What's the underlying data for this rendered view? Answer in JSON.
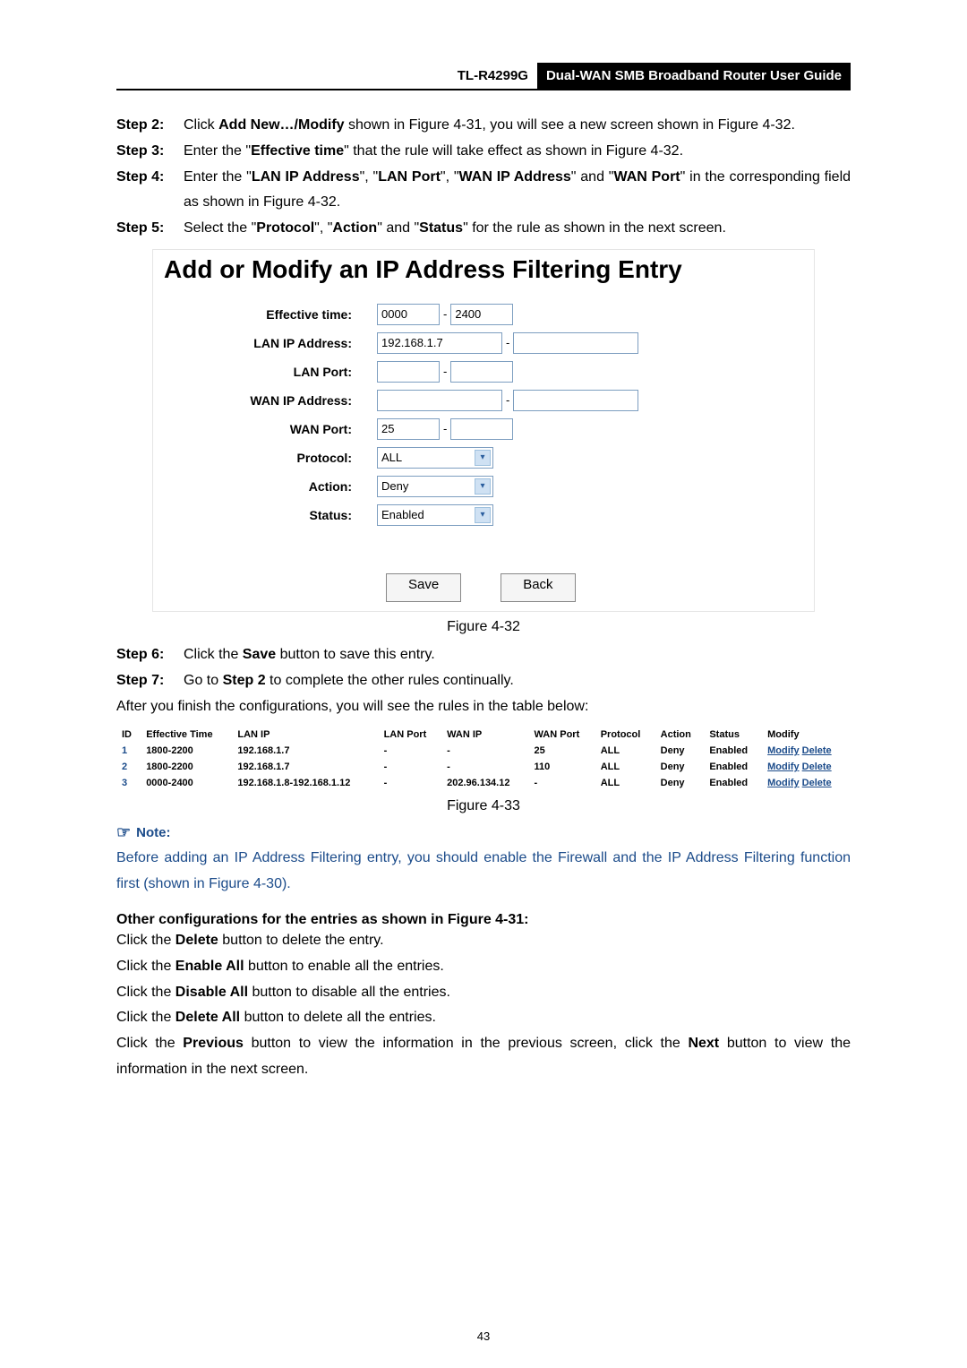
{
  "header": {
    "model": "TL-R4299G",
    "title": "Dual-WAN SMB Broadband Router User Guide"
  },
  "steps_top": {
    "s2_label": "Step 2:",
    "s2_text_1": "Click ",
    "s2_b1": "Add New…/Modify",
    "s2_text_2": " shown in Figure 4-31, you will see a new screen shown in Figure 4-32.",
    "s3_label": "Step 3:",
    "s3_text_1": "Enter the \"",
    "s3_b1": "Effective time",
    "s3_text_2": "\" that the rule will take effect as shown in Figure 4-32.",
    "s4_label": "Step 4:",
    "s4_text_1": "Enter the \"",
    "s4_b1": "LAN IP Address",
    "s4_text_2": "\", \"",
    "s4_b2": "LAN Port",
    "s4_text_3": "\", \"",
    "s4_b3": "WAN IP Address",
    "s4_text_4": "\" and \"",
    "s4_b4": "WAN Port",
    "s4_text_5": "\" in the corresponding field as shown in Figure 4-32.",
    "s5_label": "Step 5:",
    "s5_text_1": "Select the \"",
    "s5_b1": "Protocol",
    "s5_text_2": "\", \"",
    "s5_b2": "Action",
    "s5_text_3": "\" and \"",
    "s5_b3": "Status",
    "s5_text_4": "\" for the rule as shown in the next screen."
  },
  "form": {
    "title": "Add or Modify an IP Address Filtering Entry",
    "labels": {
      "effective_time": "Effective time:",
      "lan_ip": "LAN IP Address:",
      "lan_port": "LAN Port:",
      "wan_ip": "WAN IP Address:",
      "wan_port": "WAN Port:",
      "protocol": "Protocol:",
      "action": "Action:",
      "status": "Status:"
    },
    "values": {
      "effective_time_from": "0000",
      "effective_time_to": "2400",
      "lan_ip_from": "192.168.1.7",
      "lan_ip_to": "",
      "lan_port_from": "",
      "lan_port_to": "",
      "wan_ip_from": "",
      "wan_ip_to": "",
      "wan_port_from": "25",
      "wan_port_to": "",
      "protocol": "ALL",
      "action": "Deny",
      "status": "Enabled"
    },
    "buttons": {
      "save": "Save",
      "back": "Back"
    }
  },
  "caption_32": "Figure 4-32",
  "steps_mid": {
    "s6_label": "Step 6:",
    "s6_text_1": "Click the ",
    "s6_b1": "Save",
    "s6_text_2": " button to save this entry.",
    "s7_label": "Step 7:",
    "s7_text_1": "Go to ",
    "s7_b1": "Step 2",
    "s7_text_2": " to complete the other rules continually."
  },
  "after_config_line": "After you finish the configurations, you will see the rules in the table below:",
  "rules_table": {
    "headers": [
      "ID",
      "Effective Time",
      "LAN IP",
      "LAN Port",
      "WAN IP",
      "WAN Port",
      "Protocol",
      "Action",
      "Status",
      "Modify"
    ],
    "rows": [
      {
        "id": "1",
        "time": "1800-2200",
        "lan_ip": "192.168.1.7",
        "lan_port": "-",
        "wan_ip": "-",
        "wan_port": "25",
        "protocol": "ALL",
        "action": "Deny",
        "status": "Enabled",
        "modify": "Modify",
        "delete": "Delete"
      },
      {
        "id": "2",
        "time": "1800-2200",
        "lan_ip": "192.168.1.7",
        "lan_port": "-",
        "wan_ip": "-",
        "wan_port": "110",
        "protocol": "ALL",
        "action": "Deny",
        "status": "Enabled",
        "modify": "Modify",
        "delete": "Delete"
      },
      {
        "id": "3",
        "time": "0000-2400",
        "lan_ip": "192.168.1.8-192.168.1.12",
        "lan_port": "-",
        "wan_ip": "202.96.134.12",
        "wan_port": "-",
        "protocol": "ALL",
        "action": "Deny",
        "status": "Enabled",
        "modify": "Modify",
        "delete": "Delete"
      }
    ]
  },
  "caption_33": "Figure 4-33",
  "note": {
    "label": "Note:",
    "text": "Before adding an IP Address Filtering entry, you should enable the Firewall and the IP Address Filtering function first (shown in Figure 4-30)."
  },
  "other_heading": "Other configurations for the entries as shown in Figure 4-31:",
  "other": {
    "l1_a": "Click the ",
    "l1_b": "Delete",
    "l1_c": " button to delete the entry.",
    "l2_a": "Click the ",
    "l2_b": "Enable All",
    "l2_c": " button to enable all the entries.",
    "l3_a": "Click the ",
    "l3_b": "Disable All",
    "l3_c": " button to disable all the entries.",
    "l4_a": "Click the ",
    "l4_b": "Delete All",
    "l4_c": " button to delete all the entries.",
    "l5_a": "Click the ",
    "l5_b": "Previous",
    "l5_c": " button to view the information in the previous screen, click the ",
    "l5_d": "Next",
    "l5_e": " button to view the information in the next screen."
  },
  "page_number": "43"
}
